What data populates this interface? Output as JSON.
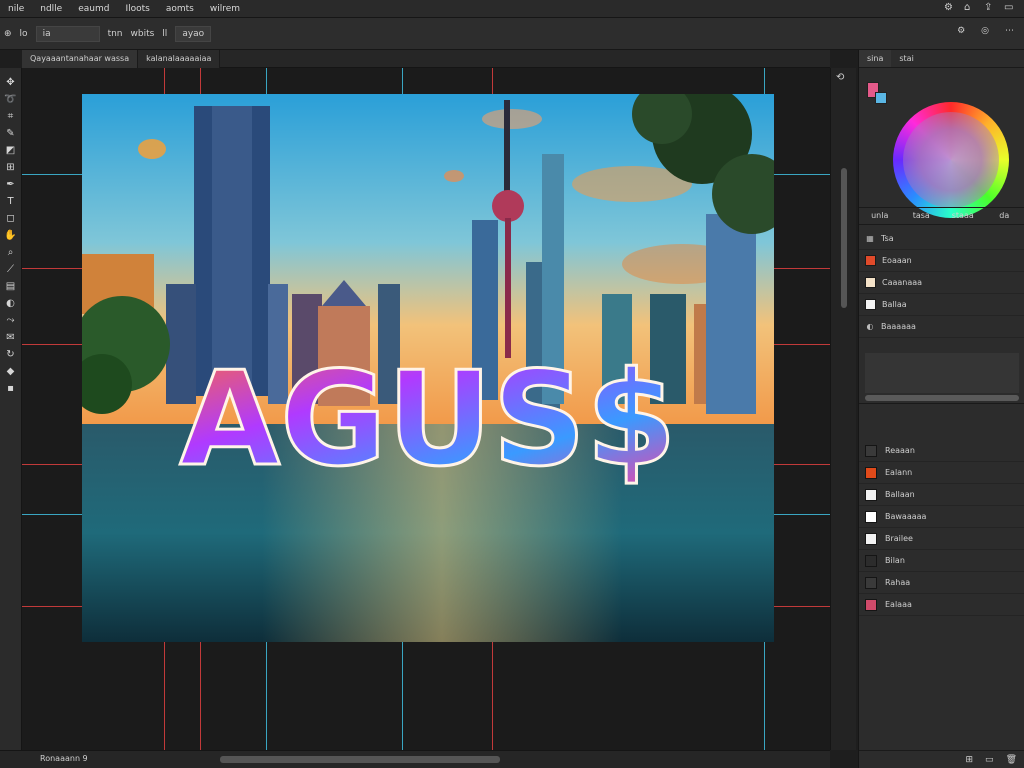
{
  "menubar": {
    "items": [
      "nile",
      "ndlle",
      "eaumd",
      "Iloots",
      "aomts",
      "wilrem"
    ],
    "right_icons": [
      "settings-icon",
      "home-icon",
      "share-icon",
      "window-icon"
    ]
  },
  "options": {
    "items": [
      "lo",
      "ia",
      "tnn",
      "wbits",
      "ll",
      "ayao"
    ],
    "right_icons": [
      "settings-icon",
      "account-icon",
      "more-icon"
    ]
  },
  "doc_tabs": [
    {
      "label": "Qayaaantanahaar wassa",
      "active": true
    },
    {
      "label": "kalanalaaaaaiaa",
      "active": false
    }
  ],
  "tools": [
    "move-icon",
    "lasso-icon",
    "crop-icon",
    "brush-icon",
    "eraser-icon",
    "stamp-icon",
    "pen-icon",
    "text-icon",
    "shape-icon",
    "hand-icon",
    "zoom-icon",
    "eyedropper-icon",
    "gradient-icon",
    "dodge-icon",
    "path-icon",
    "note-icon",
    "rotate-icon",
    "fill-icon",
    "foreground-icon"
  ],
  "artwork": {
    "text": "AGUS$"
  },
  "status": {
    "zoom": "Ronaaann 9"
  },
  "panel": {
    "tabs": [
      "sina",
      "stai"
    ],
    "subtabs": [
      "unla",
      "tasa",
      "staaa",
      "da"
    ],
    "rows": [
      {
        "label": "Tsa",
        "icon": "grid-icon"
      },
      {
        "label": "Eoaaan",
        "swatch": "#e04a2a"
      },
      {
        "label": "Caaanaaa",
        "swatch": "#f4e2c8"
      },
      {
        "label": "Ballaa",
        "swatch": "#f4f4f4"
      },
      {
        "label": "Baaaaaa",
        "icon": "adjust-icon"
      }
    ],
    "layers": [
      {
        "label": "Reaaan",
        "thumb": "#3a3a3a"
      },
      {
        "label": "Ealann",
        "thumb": "#e04a1a"
      },
      {
        "label": "Ballaan",
        "thumb": "#f2f2f2"
      },
      {
        "label": "Bawaaaaa",
        "thumb": "#ffffff"
      },
      {
        "label": "Brailee",
        "thumb": "#f2f2f2"
      },
      {
        "label": "Bilan",
        "thumb": "#2c2c2c"
      },
      {
        "label": "Rahaa",
        "thumb": "#3a3a3a"
      },
      {
        "label": "Ealaaa",
        "thumb": "#d04a6a"
      }
    ]
  },
  "colors": {
    "foreground": "#e45a8a",
    "background": "#5ab6e4"
  }
}
